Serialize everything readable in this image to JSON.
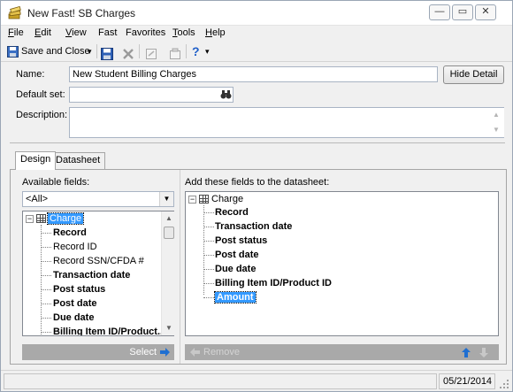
{
  "window": {
    "title": "New Fast! SB Charges",
    "icon": "fast-app-icon",
    "controls": {
      "minimize": "—",
      "restore": "▭",
      "close": "✕"
    }
  },
  "menu": [
    {
      "label": "File",
      "accel": "F",
      "rest": "ile"
    },
    {
      "label": "Edit",
      "accel": "E",
      "rest": "dit"
    },
    {
      "label": "View",
      "accel": "V",
      "rest": "iew"
    },
    {
      "label": "Fast",
      "accel": "",
      "rest": "Fast"
    },
    {
      "label": "Favorites",
      "accel": "",
      "rest": "Favorites"
    },
    {
      "label": "Tools",
      "accel": "T",
      "rest": "ools"
    },
    {
      "label": "Help",
      "accel": "H",
      "rest": "elp"
    }
  ],
  "toolbar": {
    "save_close": "Save and Close",
    "dropdown_glyph": "▾",
    "help_glyph": "?"
  },
  "form": {
    "name_label": "Name:",
    "name_value": "New Student Billing Charges",
    "hide_detail": "Hide Detail",
    "default_set_label": "Default set:",
    "default_set_value": "",
    "description_label": "Description:",
    "description_value": ""
  },
  "tabs": [
    {
      "label": "Design",
      "active": true
    },
    {
      "label": "Datasheet",
      "active": false
    }
  ],
  "available": {
    "label": "Available fields:",
    "filter": "<All>",
    "root": "Charge",
    "items": [
      {
        "label": "Record",
        "bold": true
      },
      {
        "label": "Record ID",
        "bold": false
      },
      {
        "label": "Record SSN/CFDA #",
        "bold": false
      },
      {
        "label": "Transaction date",
        "bold": true
      },
      {
        "label": "Post status",
        "bold": true
      },
      {
        "label": "Post date",
        "bold": true
      },
      {
        "label": "Due date",
        "bold": true
      },
      {
        "label": "Billing Item ID/Product...",
        "bold": true
      }
    ],
    "select_button": "Select"
  },
  "datasheet": {
    "label": "Add these fields to the datasheet:",
    "root": "Charge",
    "items": [
      {
        "label": "Record",
        "selected": false
      },
      {
        "label": "Transaction date",
        "selected": false
      },
      {
        "label": "Post status",
        "selected": false
      },
      {
        "label": "Post date",
        "selected": false
      },
      {
        "label": "Due date",
        "selected": false
      },
      {
        "label": "Billing Item ID/Product ID",
        "selected": false
      },
      {
        "label": "Amount",
        "selected": true
      }
    ],
    "remove_button": "Remove"
  },
  "status": {
    "date": "05/21/2014"
  },
  "colors": {
    "selection": "#3399ff",
    "action_bar": "#a9a9a9",
    "arrow_blue": "#1f6fd1"
  }
}
